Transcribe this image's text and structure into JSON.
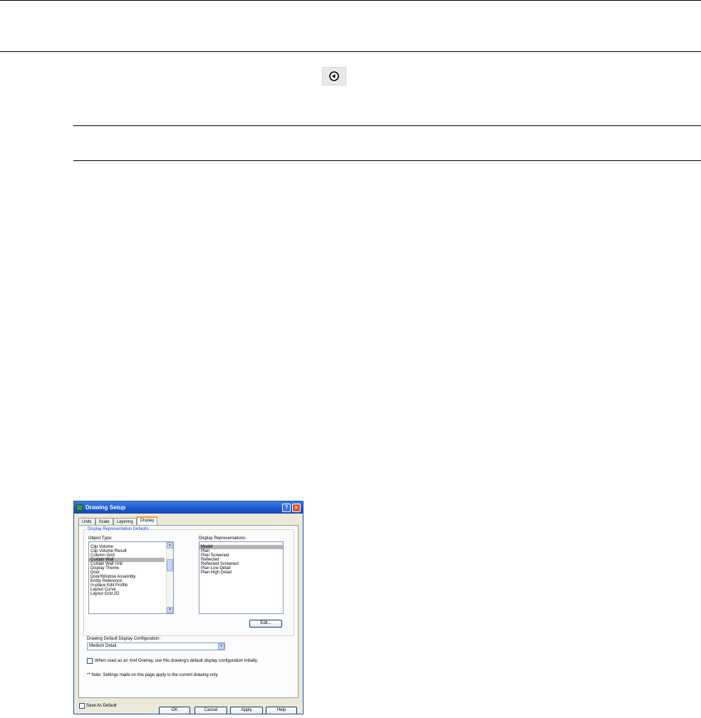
{
  "dialog": {
    "title": "Drawing Setup",
    "help_button": "?",
    "close_button": "×",
    "tabs": [
      "Units",
      "Scale",
      "Layering",
      "Display"
    ],
    "active_tab": "Display",
    "group_title": "Display Representation Defaults:",
    "object_type_label": "Object Type:",
    "object_types": [
      "Clip Volume",
      "Clip Volume Result",
      "Column Grid",
      "Curtain Wall",
      "Curtain Wall Unit",
      "Display Theme",
      "Door",
      "Door/Window Assembly",
      "Entity Reference",
      "In-place Edit Profile",
      "Layout Curve",
      "Layout Grid 2D"
    ],
    "selected_object_type": "Curtain Wall",
    "display_reps_label": "Display Representations:",
    "display_reps": [
      "Model",
      "Plan",
      "Plan Screened",
      "Reflected",
      "Reflected Screened",
      "Plan Low Detail",
      "Plan High Detail"
    ],
    "selected_display_rep": "Model",
    "edit_button": "Edit...",
    "config_label": "Drawing Default Display Configuration:",
    "config_value": "Medium Detail",
    "xref_checkbox_label": "When used as an Xref Overlay, use this drawing's default display configuration initially.",
    "note": "** Note: Settings made on this page apply to the current drawing only.",
    "save_default_label": "Save As Default",
    "buttons": {
      "ok": "OK",
      "cancel": "Cancel",
      "apply": "Apply",
      "help": "Help"
    },
    "accent": "#1b57cf"
  },
  "icons": {
    "nav": "circle-arrow-left-icon"
  }
}
